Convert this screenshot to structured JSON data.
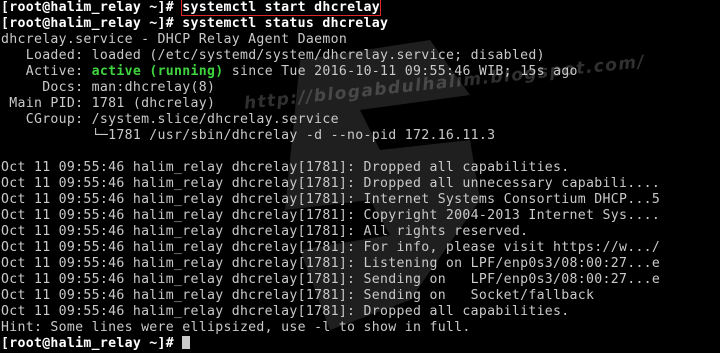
{
  "prompt": "[root@halim_relay ~]# ",
  "commands": {
    "start": "systemctl start dhcrelay",
    "status": "systemctl status dhcrelay"
  },
  "status": {
    "unit_line": "dhcrelay.service - DHCP Relay Agent Daemon",
    "loaded_label": "   Loaded:",
    "loaded_value": " loaded (/etc/systemd/system/dhcrelay.service; disabled)",
    "active_label": "   Active:",
    "active_state": "active (running)",
    "active_since": " since Tue 2016-10-11 09:55:46 WIB; 15s ago",
    "docs": "     Docs: man:dhcrelay(8)",
    "mainpid": " Main PID: 1781 (dhcrelay)",
    "cgroup": "   CGroup: /system.slice/dhcrelay.service",
    "cgroup_child": "           └─1781 /usr/sbin/dhcrelay -d --no-pid 172.16.11.3"
  },
  "log_lines": [
    "Oct 11 09:55:46 halim_relay dhcrelay[1781]: Dropped all capabilities.",
    "Oct 11 09:55:46 halim_relay dhcrelay[1781]: Dropped all unnecessary capabili....",
    "Oct 11 09:55:46 halim_relay dhcrelay[1781]: Internet Systems Consortium DHCP...5",
    "Oct 11 09:55:46 halim_relay dhcrelay[1781]: Copyright 2004-2013 Internet Sys....",
    "Oct 11 09:55:46 halim_relay dhcrelay[1781]: All rights reserved.",
    "Oct 11 09:55:46 halim_relay dhcrelay[1781]: For info, please visit https://w.../",
    "Oct 11 09:55:46 halim_relay dhcrelay[1781]: Listening on LPF/enp0s3/08:00:27...e",
    "Oct 11 09:55:46 halim_relay dhcrelay[1781]: Sending on   LPF/enp0s3/08:00:27...e",
    "Oct 11 09:55:46 halim_relay dhcrelay[1781]: Sending on   Socket/fallback",
    "Oct 11 09:55:46 halim_relay dhcrelay[1781]: Dropped all capabilities."
  ],
  "hint": "Hint: Some lines were ellipsized, use -l to show in full.",
  "watermark": "http://blogabdulhalim.blogspot.com/",
  "colors": {
    "background": "#000000",
    "text": "#c9c9c9",
    "active": "#3fd43f",
    "highlight_box": "#e0242a"
  }
}
